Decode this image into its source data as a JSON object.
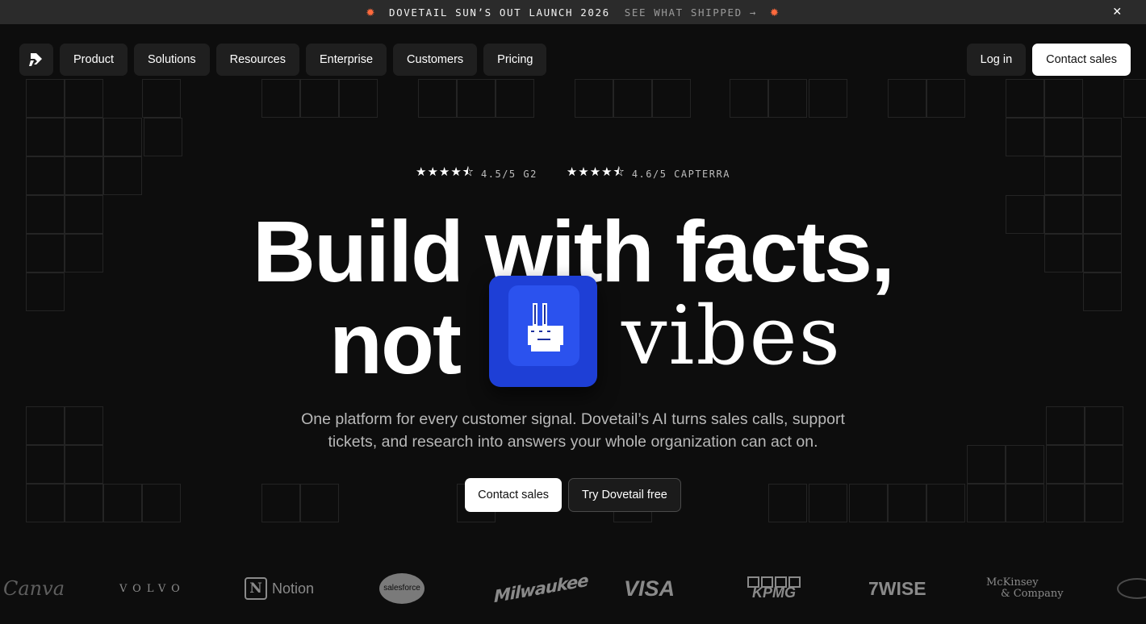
{
  "announcement": {
    "title": "DOVETAIL SUN’S OUT LAUNCH 2026",
    "link": "SEE WHAT SHIPPED →",
    "close": "✕"
  },
  "nav": {
    "items": [
      {
        "label": "Product"
      },
      {
        "label": "Solutions"
      },
      {
        "label": "Resources"
      },
      {
        "label": "Enterprise"
      },
      {
        "label": "Customers"
      },
      {
        "label": "Pricing"
      }
    ],
    "login": "Log in",
    "contact": "Contact sales"
  },
  "ratings": [
    {
      "stars": "★★★★⯪",
      "score": "4.5/5 G2"
    },
    {
      "stars": "★★★★⯪",
      "score": "4.6/5 CAPTERRA"
    }
  ],
  "hero": {
    "line1": "Build with facts,",
    "not": "not",
    "vibes": "vibes",
    "key_icon": "peace-hand-icon",
    "subtitle_1": "One platform for every customer signal. Dovetail’s AI turns sales calls, support",
    "subtitle_2": "tickets, and research into answers your whole organization can act on.",
    "cta_primary": "Contact sales",
    "cta_secondary": "Try Dovetail free"
  },
  "logos": {
    "canva": "Canva",
    "volvo": "VOLVO",
    "notion": "Notion",
    "salesforce": "salesforce",
    "milwaukee": "Milwaukee",
    "visa": "VISA",
    "kpmg": "KPMG",
    "wise": "7WISE",
    "mckinsey_1": "McKinsey",
    "mckinsey_2": "& Company"
  },
  "colors": {
    "background": "#0d0d0d",
    "announce_bg": "#2b2b2b",
    "sun": "#ff6a3d",
    "key_blue": "#2b52ee"
  }
}
